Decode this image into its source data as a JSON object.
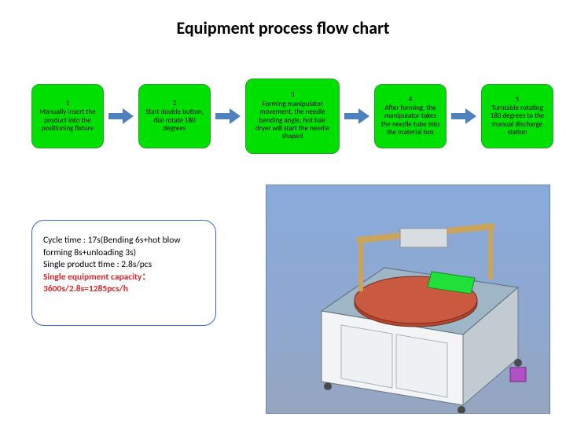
{
  "title": "Equipment process flow chart",
  "steps": [
    {
      "n": "1",
      "text": "Manually insert the product into the positioning fixture"
    },
    {
      "n": "2",
      "text": "Start double button, dial rotate 180 degrees"
    },
    {
      "n": "3",
      "text": "Forming manipulator movement, the needle bending angle, hot hair dryer will start the needle shaped"
    },
    {
      "n": "4",
      "text": "After forming, the manipulator takes the needle tube into the material box"
    },
    {
      "n": "5",
      "text": "Turntable rotating 180 degrees to the manual discharge station"
    }
  ],
  "notes": {
    "line1": "Cycle time : 17s(Bending 6s+hot blow forming 8s+unloading 3s)",
    "line2": "Single product time : 2.8s/pcs",
    "line3": "Single equipment capacity：3600s/2.8s=1285pcs/h"
  },
  "chart_data": {
    "type": "table",
    "title": "Equipment process flow chart",
    "steps": [
      {
        "order": 1,
        "description": "Manually insert the product into the positioning fixture"
      },
      {
        "order": 2,
        "description": "Start double button, dial rotate 180 degrees"
      },
      {
        "order": 3,
        "description": "Forming manipulator movement, the needle bending angle, hot hair dryer will start the needle shaped"
      },
      {
        "order": 4,
        "description": "After forming, the manipulator takes the needle tube into the material box"
      },
      {
        "order": 5,
        "description": "Turntable rotating 180 degrees to the manual discharge station"
      }
    ],
    "cycle_time_s": 17,
    "cycle_breakdown_s": {
      "bending": 6,
      "hot_blow_forming": 8,
      "unloading": 3
    },
    "single_product_time_s": 2.8,
    "equipment_capacity_pcs_per_h": 1285,
    "capacity_formula": "3600s / 2.8s = 1285 pcs/h"
  }
}
